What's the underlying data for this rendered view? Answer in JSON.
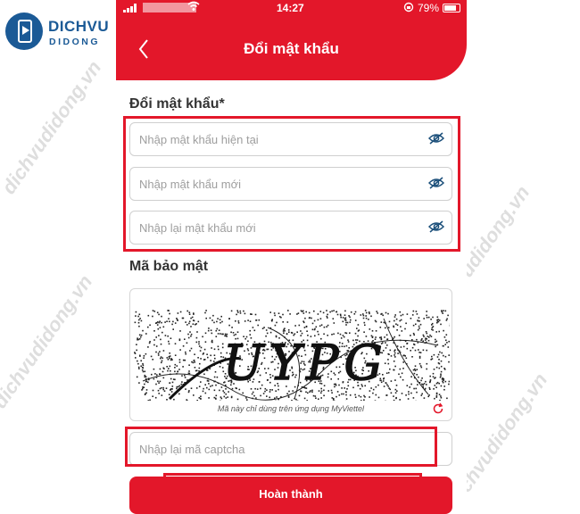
{
  "watermark": {
    "brand_line1": "DICHVU",
    "brand_line2": "DIDONG",
    "diagonal_text": "dichvudidong.vn"
  },
  "statusbar": {
    "time": "14:27",
    "battery": "79%"
  },
  "header": {
    "title": "Đổi mật khẩu",
    "back_icon": "chevron-left-icon"
  },
  "password_section": {
    "title": "Đổi mật khẩu*",
    "fields": [
      {
        "placeholder": "Nhập mật khẩu hiện tại",
        "icon": "eye-off-icon"
      },
      {
        "placeholder": "Nhập mật khẩu mới",
        "icon": "eye-off-icon"
      },
      {
        "placeholder": "Nhập lại mật khẩu mới",
        "icon": "eye-off-icon"
      }
    ]
  },
  "captcha_section": {
    "title": "Mã bảo mật",
    "captcha_text": "UYPG",
    "note": "Mã này chỉ dùng trên ứng dụng MyViettel",
    "refresh_icon": "refresh-icon",
    "input_placeholder": "Nhập lại mã captcha"
  },
  "submit": {
    "label": "Hoàn thành"
  },
  "colors": {
    "primary": "#e3172a",
    "icon": "#1b4f7a",
    "brand": "#1b5a96"
  }
}
